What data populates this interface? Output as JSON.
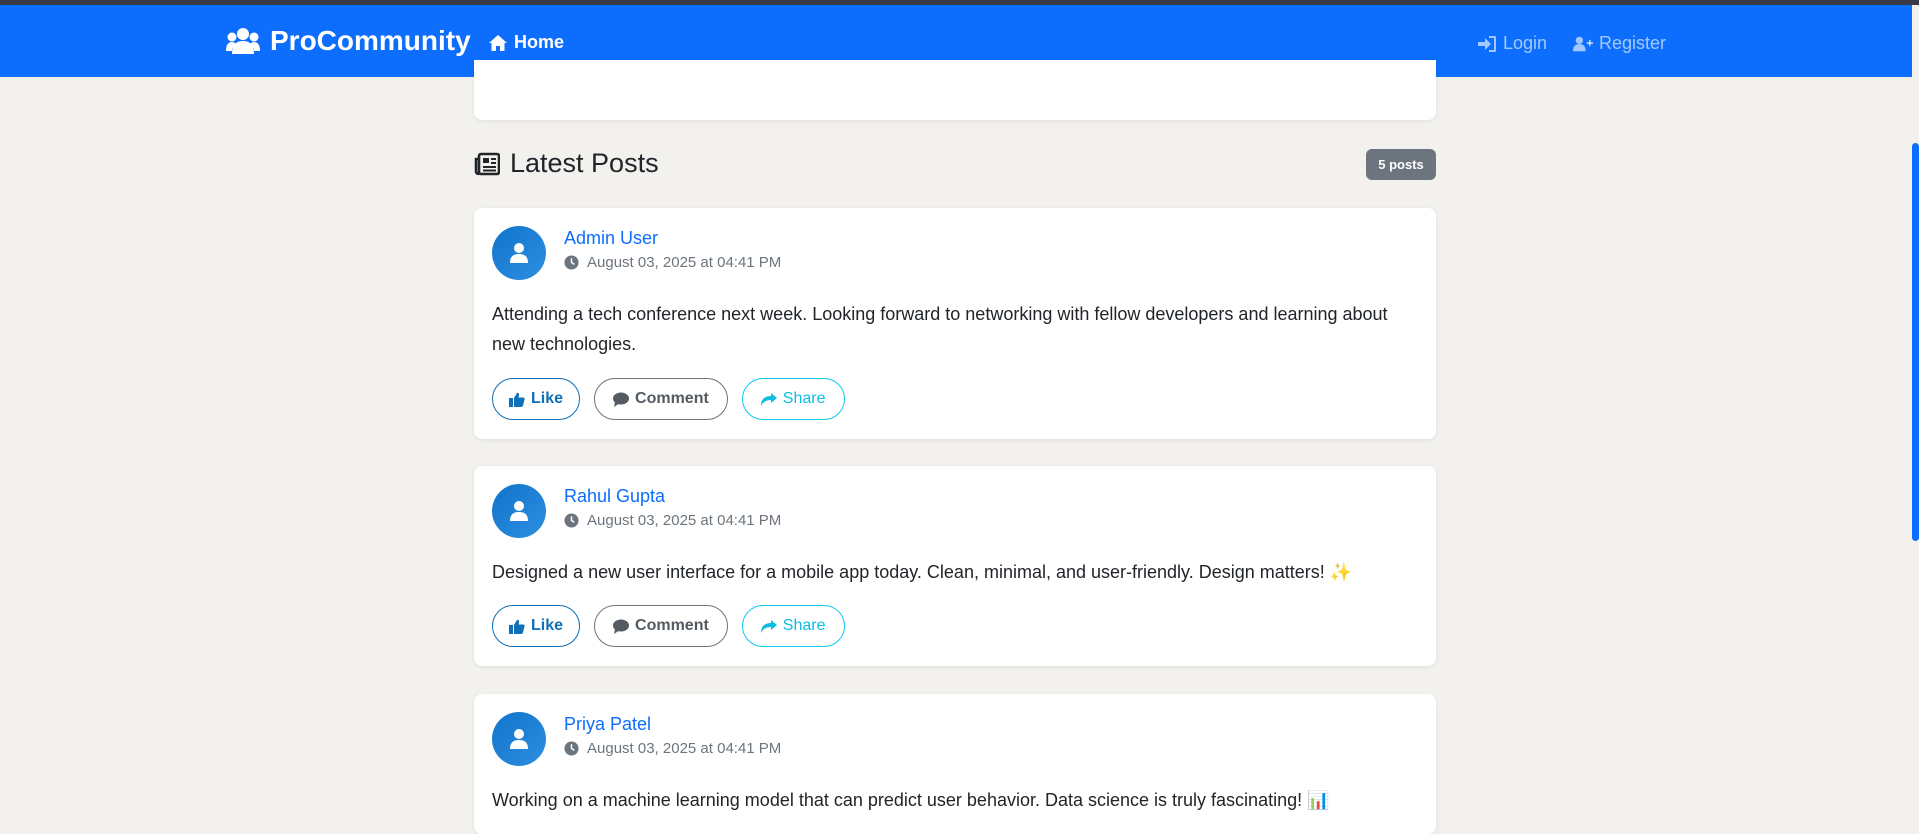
{
  "navbar": {
    "brand": "ProCommunity",
    "home": "Home",
    "login": "Login",
    "register": "Register"
  },
  "feed": {
    "heading": "Latest Posts",
    "count_badge": "5 posts",
    "posts": [
      {
        "author": "Admin User",
        "timestamp": "August 03, 2025 at 04:41 PM",
        "text": "Attending a tech conference next week. Looking forward to networking with fellow developers and learning about new technologies."
      },
      {
        "author": "Rahul Gupta",
        "timestamp": "August 03, 2025 at 04:41 PM",
        "text": "Designed a new user interface for a mobile app today. Clean, minimal, and user-friendly. Design matters! ✨"
      },
      {
        "author": "Priya Patel",
        "timestamp": "August 03, 2025 at 04:41 PM",
        "text": "Working on a machine learning model that can predict user behavior. Data science is truly fascinating! 📊"
      }
    ]
  },
  "actions": {
    "like": "Like",
    "comment": "Comment",
    "share": "Share"
  },
  "icons": {
    "brand": "users-icon",
    "home": "home-icon",
    "login": "sign-in-icon",
    "register": "user-plus-icon",
    "heading": "newspaper-icon",
    "avatar": "user-icon",
    "timestamp": "clock-icon",
    "like": "thumbs-up-icon",
    "comment": "comment-icon",
    "share": "share-icon"
  },
  "colors": {
    "primary": "#0d6efd",
    "badge": "#6c757d",
    "share": "#0dcaf0",
    "background": "#f2f1ee"
  }
}
